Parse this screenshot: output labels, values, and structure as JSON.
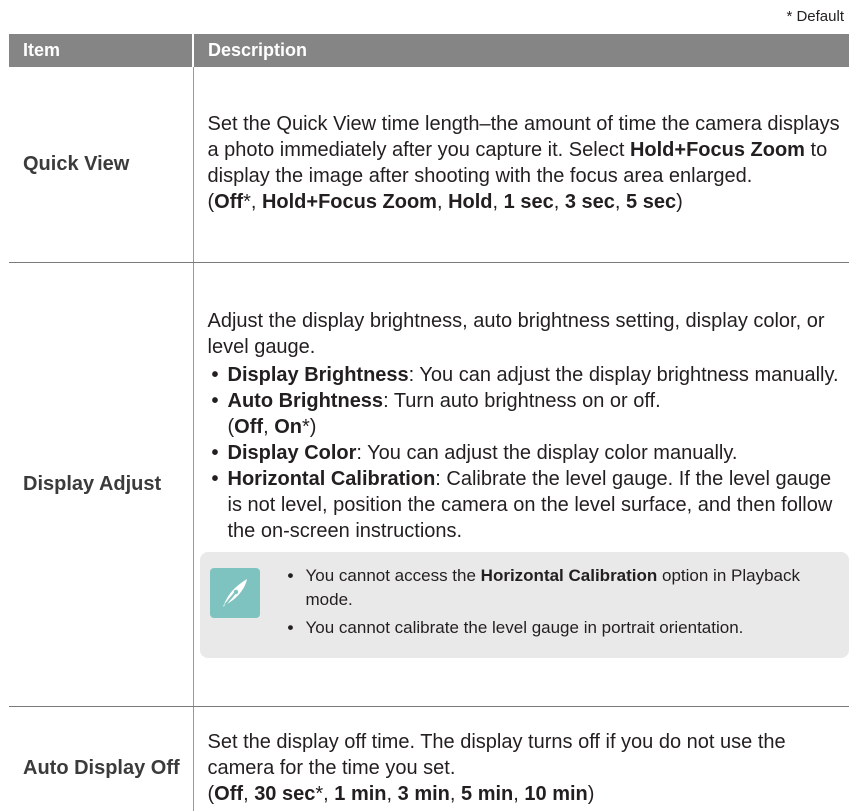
{
  "default_note": "* Default",
  "header": {
    "item": "Item",
    "description": "Description"
  },
  "rows": {
    "quick_view": {
      "item": "Quick View",
      "text1": "Set the Quick View time length–the amount of time the camera displays a photo immediately after you capture it. Select ",
      "bold1": "Hold+Focus Zoom",
      "text2": " to display the image after shooting with the focus area enlarged.",
      "options": [
        "Off",
        "Hold+Focus Zoom",
        "Hold",
        "1 sec",
        "3 sec",
        "5 sec"
      ]
    },
    "display_adjust": {
      "item": "Display Adjust",
      "intro": "Adjust the display brightness, auto brightness setting, display color, or level gauge.",
      "bullets": [
        {
          "term": "Display Brightness",
          "text": ": You can adjust the display brightness manually."
        },
        {
          "term": "Auto Brightness",
          "text": ": Turn auto brightness on or off.",
          "opt_off": "Off",
          "opt_on": "On"
        },
        {
          "term": "Display Color",
          "text": ": You can adjust the display color manually."
        },
        {
          "term": "Horizontal Calibration",
          "text": ": Calibrate the level gauge. If the level gauge is not level, position the camera on the level surface, and then follow the on-screen instructions."
        }
      ],
      "note": {
        "icon": "pen-nib-icon",
        "items": [
          {
            "pre": "You cannot access the ",
            "bold": "Horizontal Calibration",
            "post": " option in Playback mode."
          },
          {
            "text": "You cannot calibrate the level gauge in portrait orientation."
          }
        ]
      }
    },
    "auto_display_off": {
      "item": "Auto Display Off",
      "text": "Set the display off time. The display turns off if you do not use the camera for the time you set.",
      "options": [
        "Off",
        "30 sec",
        "1 min",
        "3 min",
        "5 min",
        "10 min"
      ]
    }
  },
  "colors": {
    "header_bg": "#858585",
    "note_bg": "#e9e9e9",
    "note_icon_bg": "#7fc3c0"
  }
}
